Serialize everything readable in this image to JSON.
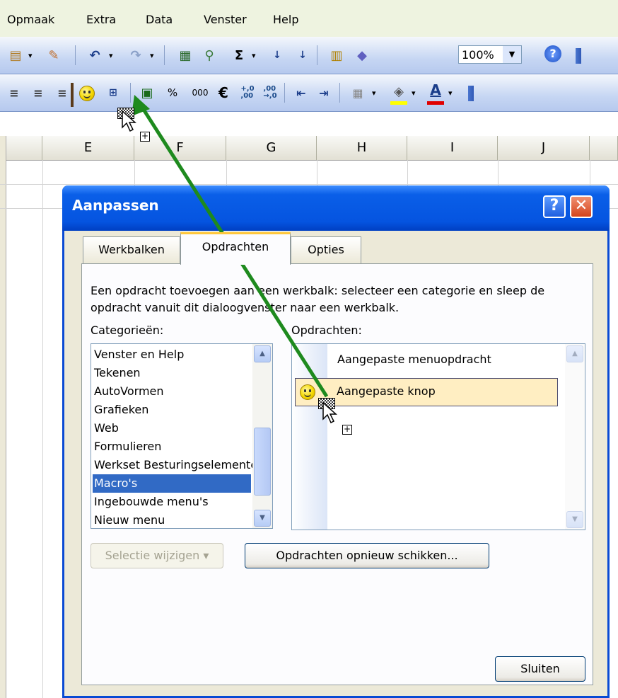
{
  "menubar": {
    "items": [
      "Opmaak",
      "Extra",
      "Data",
      "Venster",
      "Help"
    ]
  },
  "toolbar1": {
    "zoom_value": "100%",
    "icons": [
      "paste-icon",
      "format-painter-icon",
      "undo-icon",
      "redo-icon",
      "insert-hyperlink-icon",
      "autosum-icon",
      "sort-ascending-icon",
      "sort-descending-icon",
      "chart-wizard-icon",
      "drawing-icon",
      "help-icon"
    ],
    "sigma": "Σ"
  },
  "toolbar2": {
    "percent": "%",
    "thousands": "000",
    "euro": "€",
    "increase_decimal": "+,0\n,00",
    "decrease_decimal": ",00\n→,0",
    "font_color_letter": "A"
  },
  "sheet": {
    "columns": [
      "E",
      "F",
      "G",
      "H",
      "I",
      "J"
    ]
  },
  "dialog": {
    "title": "Aanpassen",
    "help_glyph": "?",
    "close_glyph": "✕",
    "tabs": [
      "Werkbalken",
      "Opdrachten",
      "Opties"
    ],
    "active_tab": "Opdrachten",
    "instruction": "Een opdracht toevoegen aan een werkbalk: selecteer een categorie en sleep de opdracht vanuit dit dialoogvenster naar een werkbalk.",
    "categories_label": "Categorieën:",
    "commands_label": "Opdrachten:",
    "categories": [
      "Venster en Help",
      "Tekenen",
      "AutoVormen",
      "Grafieken",
      "Web",
      "Formulieren",
      "Werkset Besturingselementen",
      "Macro's",
      "Ingebouwde menu's",
      "Nieuw menu"
    ],
    "selected_category": "Macro's",
    "commands": [
      "Aangepaste menuopdracht",
      "Aangepaste knop"
    ],
    "selected_command": "Aangepaste knop",
    "modify_selection_button": "Selectie wijzigen ▾",
    "rearrange_button": "Opdrachten opnieuw schikken...",
    "close_button": "Sluiten"
  },
  "colors": {
    "arrow": "#1e8a1e",
    "titlebar": "#0554e0",
    "selection": "#316ac5",
    "active_tab_accent": "#ffc83c"
  }
}
